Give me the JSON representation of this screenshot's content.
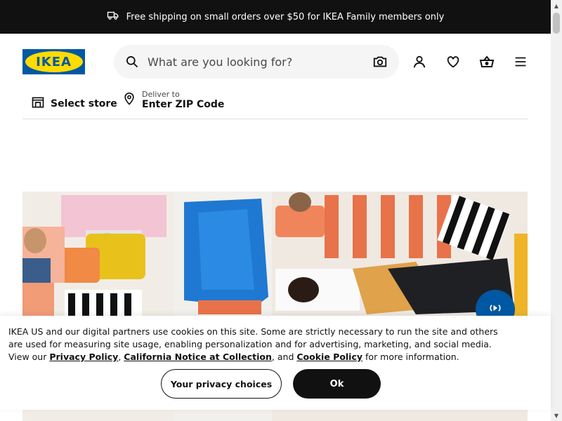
{
  "banner": {
    "text": "Free shipping on small orders over $50 for IKEA Family members only",
    "icon": "truck-icon"
  },
  "header": {
    "logo_text": "IKEA",
    "search_placeholder": "What are you looking for?",
    "icons": [
      "search-icon",
      "camera-icon",
      "user-icon",
      "heart-icon",
      "basket-icon",
      "menu-icon"
    ]
  },
  "location": {
    "store_label": "Select store",
    "deliver_to": "Deliver to",
    "zip_label": "Enter ZIP Code"
  },
  "hero": {
    "sound_button_icon": "audio-icon"
  },
  "cookie": {
    "text_1": "IKEA US and our digital partners use cookies on this site. Some are strictly necessary to run the site and others are used for measuring site usage, enabling personalization and for advertising, marketing, and social media. View our",
    "privacy_link": "Privacy Policy",
    "comma": ",",
    "california_link": "California Notice at Collection",
    "and": ", and",
    "cookie_link": "Cookie Policy",
    "text_2": "for more information.",
    "choices_button": "Your privacy choices",
    "ok_button": "Ok"
  },
  "colors": {
    "brand_blue": "#0058a3",
    "brand_yellow": "#ffdb00",
    "banner_bg": "#111111"
  }
}
